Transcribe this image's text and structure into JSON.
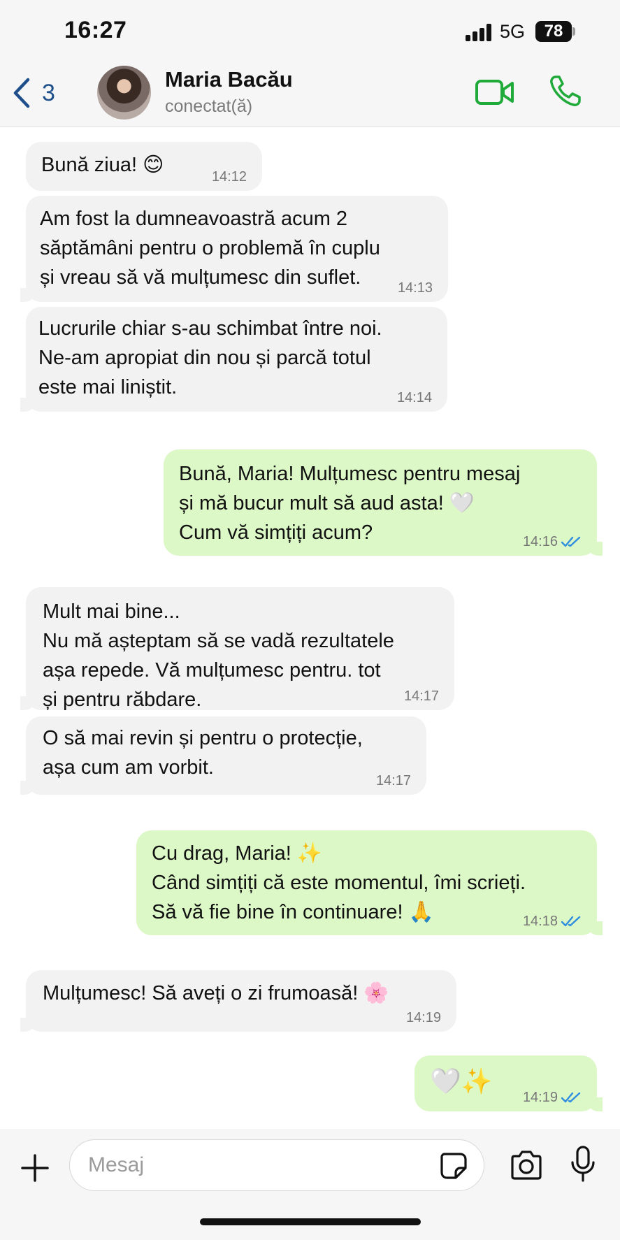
{
  "status_bar": {
    "time": "16:27",
    "network": "5G",
    "battery": "78"
  },
  "header": {
    "back_count": "3",
    "contact_name": "Maria Bacău",
    "contact_status": "conectat(ă)",
    "icons": {
      "back": "chevron-left-icon",
      "video": "video-call-icon",
      "call": "phone-icon"
    }
  },
  "messages": [
    {
      "dir": "in",
      "text": "Bună ziua! 😊",
      "time": "14:12"
    },
    {
      "dir": "in",
      "text": "Am fost la dumneavoastră acum 2\nsăptămâni pentru o problemă în cuplu\nși vreau să vă mulțumesc din suflet.",
      "time": "14:13"
    },
    {
      "dir": "in",
      "text": "Lucrurile chiar s-au schimbat între noi.\nNe-am apropiat din nou și parcă totul\neste mai liniștit.",
      "time": "14:14"
    },
    {
      "dir": "out",
      "text": "Bună, Maria! Mulțumesc pentru mesaj\nși mă bucur mult să aud asta! 🤍\nCum vă simțiți acum?",
      "time": "14:16"
    },
    {
      "dir": "in",
      "text": "Mult mai bine...\nNu mă așteptam să se vadă rezultatele\nașa repede. Vă mulțumesc pentru. tot\nși pentru răbdare.",
      "time": "14:17"
    },
    {
      "dir": "in",
      "text": "O să mai revin și pentru o protecție,\nașa cum am vorbit.",
      "time": "14:17"
    },
    {
      "dir": "out",
      "text": "Cu drag, Maria! ✨\nCând simțiți că este momentul, îmi scrieți.\nSă vă fie bine în continuare! 🙏",
      "time": "14:18"
    },
    {
      "dir": "in",
      "text": "Mulțumesc! Să aveți o zi frumoasă! 🌸",
      "time": "14:19"
    },
    {
      "dir": "out",
      "text": "🤍✨",
      "time": "14:19"
    }
  ],
  "input": {
    "placeholder": "Mesaj"
  },
  "colors": {
    "accent_green": "#1faa3a",
    "bubble_out": "#dcf8c6",
    "bubble_in": "#f2f2f2",
    "read_ticks": "#2f8ee0",
    "back_blue": "#1e4f8a"
  }
}
